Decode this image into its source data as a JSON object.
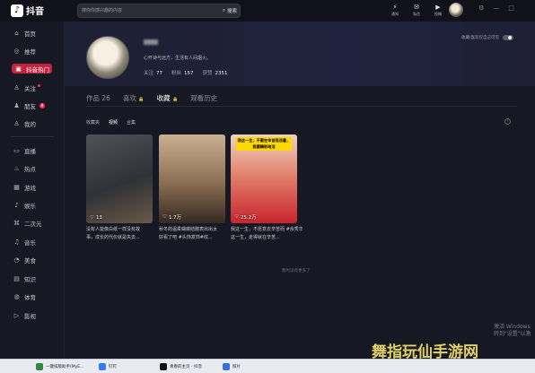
{
  "app": {
    "name": "抖音",
    "logo_glyph": "♪"
  },
  "search": {
    "placeholder": "搜你你感兴趣的内容",
    "button_label": "搜索"
  },
  "top_actions": [
    {
      "icon": "bolt-icon",
      "glyph": "⚡",
      "label": "通知"
    },
    {
      "icon": "message-icon",
      "glyph": "✉",
      "label": "私信"
    },
    {
      "icon": "tv-icon",
      "glyph": "▶",
      "label": "投稿"
    }
  ],
  "window_controls": {
    "settings": "⚙",
    "minimize": "—",
    "maximize": "□"
  },
  "sidebar": {
    "items": [
      {
        "label": "首页",
        "icon": "home-icon",
        "glyph": "⌂"
      },
      {
        "label": "推荐",
        "icon": "recommend-icon",
        "glyph": "◎"
      },
      {
        "label": "抖音热门",
        "icon": "hot-icon",
        "glyph": "▣"
      },
      {
        "label": "关注",
        "icon": "follow-icon",
        "glyph": "♙"
      },
      {
        "label": "朋友",
        "icon": "friends-icon",
        "glyph": "♟",
        "badge": "8"
      },
      {
        "label": "我的",
        "icon": "mine-icon",
        "glyph": "♙"
      },
      {
        "label": "直播",
        "icon": "live-icon",
        "glyph": "▭"
      },
      {
        "label": "热点",
        "icon": "trending-icon",
        "glyph": "♨"
      },
      {
        "label": "游戏",
        "icon": "game-icon",
        "glyph": "▦"
      },
      {
        "label": "娱乐",
        "icon": "entertainment-icon",
        "glyph": "♪"
      },
      {
        "label": "二次元",
        "icon": "anime-icon",
        "glyph": "⌘"
      },
      {
        "label": "音乐",
        "icon": "music-icon",
        "glyph": "♫"
      },
      {
        "label": "美食",
        "icon": "food-icon",
        "glyph": "◔"
      },
      {
        "label": "知识",
        "icon": "knowledge-icon",
        "glyph": "▤"
      },
      {
        "label": "体育",
        "icon": "sports-icon",
        "glyph": "◍"
      },
      {
        "label": "影视",
        "icon": "film-icon",
        "glyph": "▷"
      }
    ]
  },
  "profile": {
    "bio": "心怀诗与远方，生活有人间烟火。",
    "stats": [
      {
        "label": "关注",
        "value": "77"
      },
      {
        "label": "粉丝",
        "value": "157"
      },
      {
        "label": "获赞",
        "value": "2351"
      }
    ],
    "privacy_label": "收藏/喜欢仅自己可见"
  },
  "tabs": [
    {
      "label": "作品 26",
      "active": false
    },
    {
      "label": "喜欢",
      "locked": true,
      "active": false
    },
    {
      "label": "收藏",
      "locked": true,
      "active": true
    },
    {
      "label": "观看历史",
      "active": false
    }
  ],
  "lock_glyph": "🔒",
  "subtabs": [
    {
      "label": "收藏夹",
      "active": false
    },
    {
      "label": "视频",
      "active": true
    },
    {
      "label": "合集",
      "active": false
    }
  ],
  "help_glyph": "?",
  "cards": [
    {
      "likes": "13",
      "caption_line1": "没有人能像白纸一样没有故",
      "caption_line2": "事，成长的代价就是失去..."
    },
    {
      "likes": "1.7万",
      "caption_line1": "秋冬的温柔蝴蝶结腕表出出太",
      "caption_line2": "好看了吧 #头饰发饰#纹..."
    },
    {
      "likes": "25.2万",
      "caption_line1": "我这一生，不愿意去辛苦而 #余秀华 发文:我",
      "caption_line2": "这一生，走得就在辛苦...",
      "banner": "我这一生，不要在辛苦而活着，我要精彩地活"
    }
  ],
  "heart_glyph": "♡",
  "no_more_text": "暂时没有更多了",
  "os_watermark": {
    "line1": "激活 Windows",
    "line2": "转到\"设置\"以激"
  },
  "site_watermark": "舞指玩仙手游网",
  "taskbar": [
    {
      "label": "一键排版助手(MyE...",
      "color": "#2e8b3a"
    },
    {
      "label": "钉钉",
      "color": "#2f7df6"
    },
    {
      "label": "青春的主页 - 抖音",
      "color": "#111111"
    },
    {
      "label": "照片",
      "color": "#3b6fd8"
    }
  ]
}
